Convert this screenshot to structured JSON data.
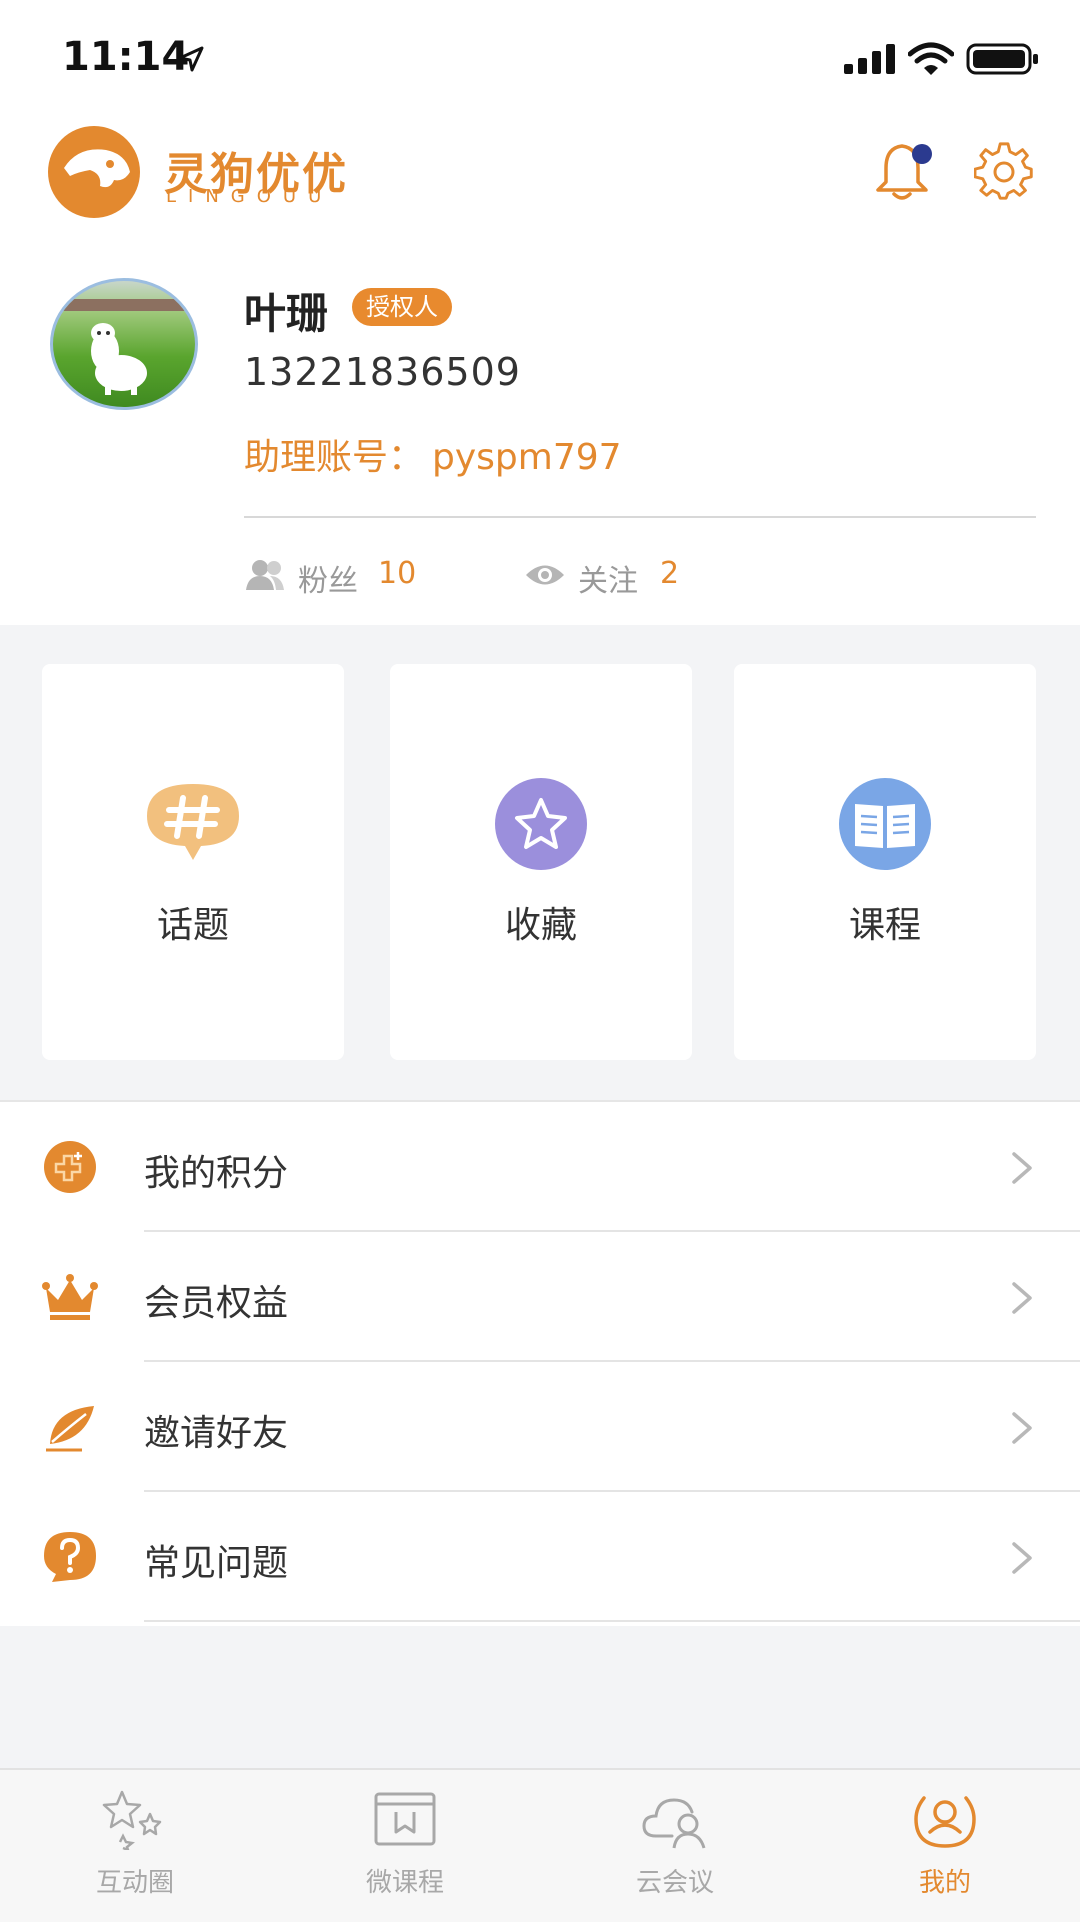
{
  "status_bar": {
    "time": "11:14"
  },
  "header": {
    "logo_cn": "灵狗优优",
    "logo_en": "LINGOUU",
    "notification_dot": true
  },
  "profile": {
    "name": "叶珊",
    "badge": "授权人",
    "phone": "13221836509",
    "assistant_label": "助理账号：",
    "assistant_value": "pyspm797",
    "fans_label": "粉丝",
    "fans_count": "10",
    "follow_label": "关注",
    "follow_count": "2"
  },
  "cards": [
    {
      "label": "话题",
      "icon": "hashtag-bubble-icon",
      "color": "#f2c07e"
    },
    {
      "label": "收藏",
      "icon": "star-icon",
      "color": "#9b8fdc"
    },
    {
      "label": "课程",
      "icon": "book-icon",
      "color": "#7aa6e6"
    }
  ],
  "menu": [
    {
      "label": "我的积分",
      "icon": "points-icon"
    },
    {
      "label": "会员权益",
      "icon": "crown-icon"
    },
    {
      "label": "邀请好友",
      "icon": "feather-icon"
    },
    {
      "label": "常见问题",
      "icon": "question-icon"
    }
  ],
  "tabs": [
    {
      "label": "互动圈",
      "icon": "stars-icon",
      "active": false
    },
    {
      "label": "微课程",
      "icon": "course-icon",
      "active": false
    },
    {
      "label": "云会议",
      "icon": "cloud-meeting-icon",
      "active": false
    },
    {
      "label": "我的",
      "icon": "profile-icon",
      "active": true
    }
  ],
  "colors": {
    "accent": "#e3892f",
    "background": "#f3f4f6"
  }
}
